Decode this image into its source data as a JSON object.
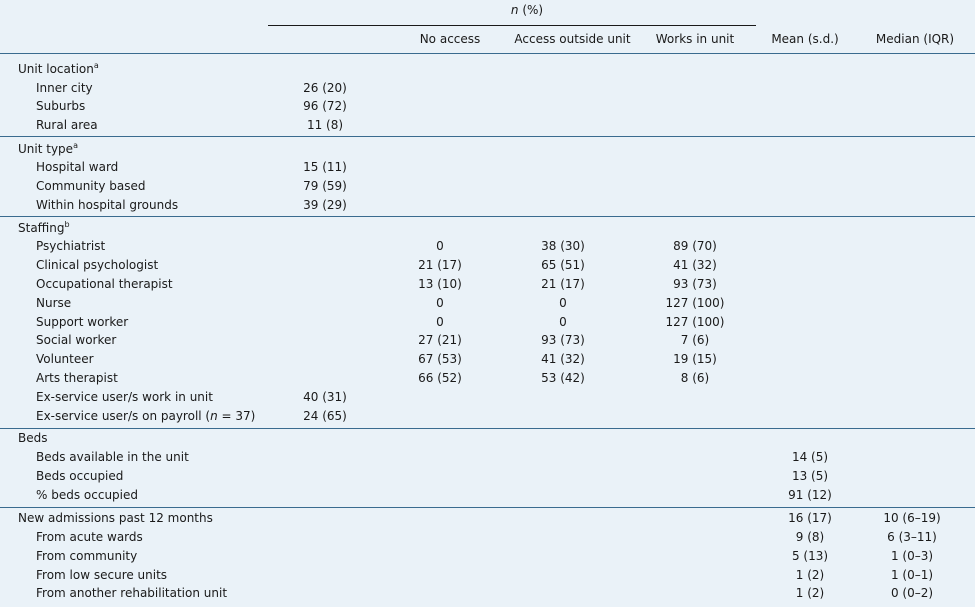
{
  "header": {
    "n_pct_label": "n (%)",
    "columns": [
      "No access",
      "Access outside unit",
      "Works in unit",
      "Mean (s.d.)",
      "Median (IQR)"
    ]
  },
  "sections": [
    {
      "title": "Unit location",
      "sup": "a",
      "rows": [
        {
          "label": "Inner city",
          "n": "26 (20)"
        },
        {
          "label": "Suburbs",
          "n": "96 (72)"
        },
        {
          "label": "Rural area",
          "n": "11 (8)"
        }
      ]
    },
    {
      "title": "Unit type",
      "sup": "a",
      "rows": [
        {
          "label": "Hospital ward",
          "n": "15 (11)"
        },
        {
          "label": "Community based",
          "n": "79 (59)"
        },
        {
          "label": "Within hospital grounds",
          "n": "39 (29)"
        }
      ]
    },
    {
      "title": "Staffing",
      "sup": "b",
      "rows": [
        {
          "label": "Psychiatrist",
          "no_access": "0",
          "outside": "38 (30)",
          "works": "89 (70)"
        },
        {
          "label": "Clinical psychologist",
          "no_access": "21 (17)",
          "outside": "65 (51)",
          "works": "41 (32)"
        },
        {
          "label": "Occupational therapist",
          "no_access": "13 (10)",
          "outside": "21 (17)",
          "works": "93 (73)"
        },
        {
          "label": "Nurse",
          "no_access": "0",
          "outside": "0",
          "works": "127 (100)"
        },
        {
          "label": "Support worker",
          "no_access": "0",
          "outside": "0",
          "works": "127 (100)"
        },
        {
          "label": "Social worker",
          "no_access": "27 (21)",
          "outside": "93 (73)",
          "works": "7 (6)"
        },
        {
          "label": "Volunteer",
          "no_access": "67 (53)",
          "outside": "41 (32)",
          "works": "19 (15)"
        },
        {
          "label": "Arts therapist",
          "no_access": "66 (52)",
          "outside": "53 (42)",
          "works": "8 (6)"
        },
        {
          "label": "Ex-service user/s work in unit",
          "n": "40 (31)"
        },
        {
          "label_pre": "Ex-service user/s on payroll (",
          "label_n": "n",
          "label_post": " = 37)",
          "n": "24 (65)"
        }
      ]
    },
    {
      "title": "Beds",
      "rows": [
        {
          "label": "Beds available in the unit",
          "mean": "14 (5)"
        },
        {
          "label": "Beds occupied",
          "mean": "13 (5)"
        },
        {
          "label": "% beds occupied",
          "mean": "91 (12)"
        }
      ]
    },
    {
      "title": "New admissions past 12 months",
      "mean": "16 (17)",
      "median": "10 (6–19)",
      "rows": [
        {
          "label": "From acute wards",
          "mean": "9 (8)",
          "median": "6 (3–11)"
        },
        {
          "label": "From community",
          "mean": "5 (13)",
          "median": "1 (0–3)"
        },
        {
          "label": "From low secure units",
          "mean": "1 (2)",
          "median": "1 (0–1)"
        },
        {
          "label": "From another rehabilitation unit",
          "mean": "1 (2)",
          "median": "0 (0–2)"
        }
      ]
    }
  ]
}
